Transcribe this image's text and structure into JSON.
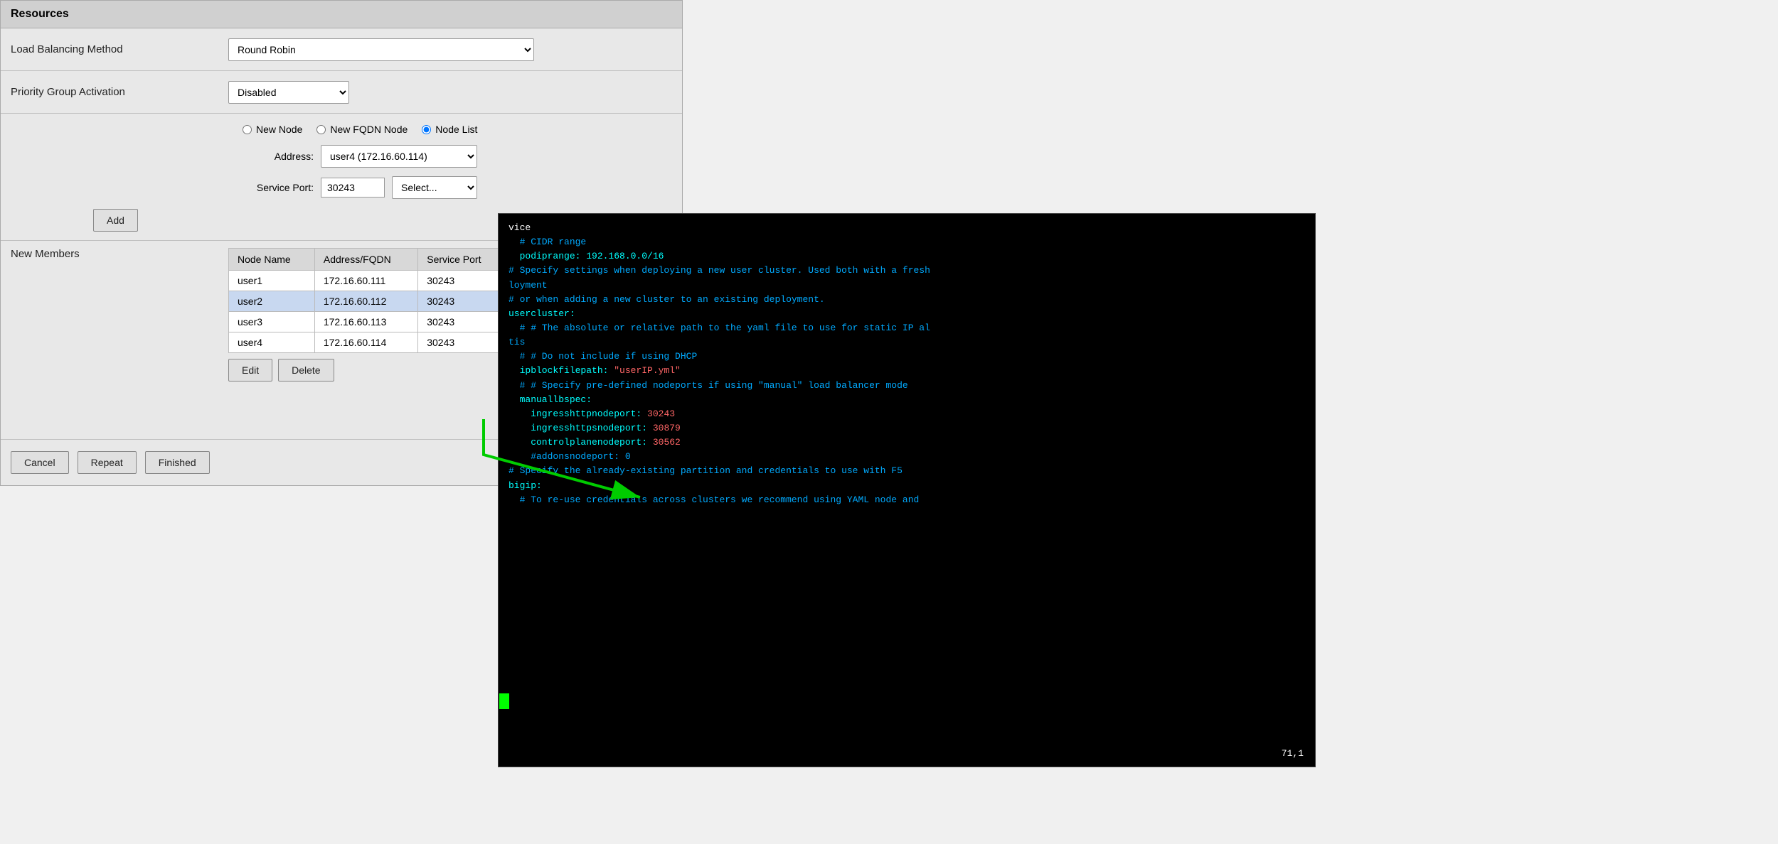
{
  "panel": {
    "title": "Resources",
    "load_balancing_label": "Load Balancing Method",
    "load_balancing_value": "Round Robin",
    "priority_label": "Priority Group Activation",
    "priority_value": "Disabled",
    "node_types": [
      "New Node",
      "New FQDN Node",
      "Node List"
    ],
    "node_selected": "Node List",
    "address_label": "Address:",
    "address_value": "user4 (172.16.60.114)",
    "service_port_label": "Service Port:",
    "service_port_value": "30243",
    "select_placeholder": "Select...",
    "add_button": "Add",
    "new_members_label": "New Members",
    "table_headers": [
      "Node Name",
      "Address/FQDN",
      "Service Port"
    ],
    "members": [
      {
        "name": "user1",
        "address": "172.16.60.111",
        "port": "30243"
      },
      {
        "name": "user2",
        "address": "172.16.60.112",
        "port": "30243"
      },
      {
        "name": "user3",
        "address": "172.16.60.113",
        "port": "30243"
      },
      {
        "name": "user4",
        "address": "172.16.60.114",
        "port": "30243"
      }
    ],
    "edit_button": "Edit",
    "delete_button": "Delete",
    "cancel_button": "Cancel",
    "repeat_button": "Repeat",
    "finished_button": "Finished"
  },
  "terminal": {
    "lines": [
      {
        "text": "vice",
        "style": "term-white"
      },
      {
        "text": "  # CIDR range",
        "style": "term-comment"
      },
      {
        "text": "  podiprange: 192.168.0.0/16",
        "style": "term-cyan"
      },
      {
        "text": "# Specify settings when deploying a new user cluster. Used both with a fresh",
        "style": "term-comment"
      },
      {
        "text": "loyment",
        "style": "term-comment"
      },
      {
        "text": "# or when adding a new cluster to an existing deployment.",
        "style": "term-comment"
      },
      {
        "text": "usercluster:",
        "style": "term-cyan"
      },
      {
        "text": "  # # The absolute or relative path to the yaml file to use for static IP al",
        "style": "term-comment"
      },
      {
        "text": "tis",
        "style": "term-comment"
      },
      {
        "text": "  # # Do not include if using DHCP",
        "style": "term-comment"
      },
      {
        "text": "  ipblockfilepath: \"userIP.yml\"",
        "style": "term-cyan"
      },
      {
        "text": "  # # Specify pre-defined nodeports if using \"manual\" load balancer mode",
        "style": "term-comment"
      },
      {
        "text": "  manuallbspec:",
        "style": "term-cyan"
      },
      {
        "text": "    ingresshttpnodeport: 30243",
        "style": "term-val"
      },
      {
        "text": "    ingresshttpsnodeport: 30879",
        "style": "term-val"
      },
      {
        "text": "    controlplanenodeport: 30562",
        "style": "term-val"
      },
      {
        "text": "    #addonsnodeport: 0",
        "style": "term-comment"
      },
      {
        "text": "# Specify the already-existing partition and credentials to use with F5",
        "style": "term-comment"
      },
      {
        "text": "bigip:",
        "style": "term-cyan"
      },
      {
        "text": "  # To re-use credentials across clusters we recommend using YAML node and",
        "style": "term-comment"
      }
    ],
    "footer": "71,1"
  }
}
